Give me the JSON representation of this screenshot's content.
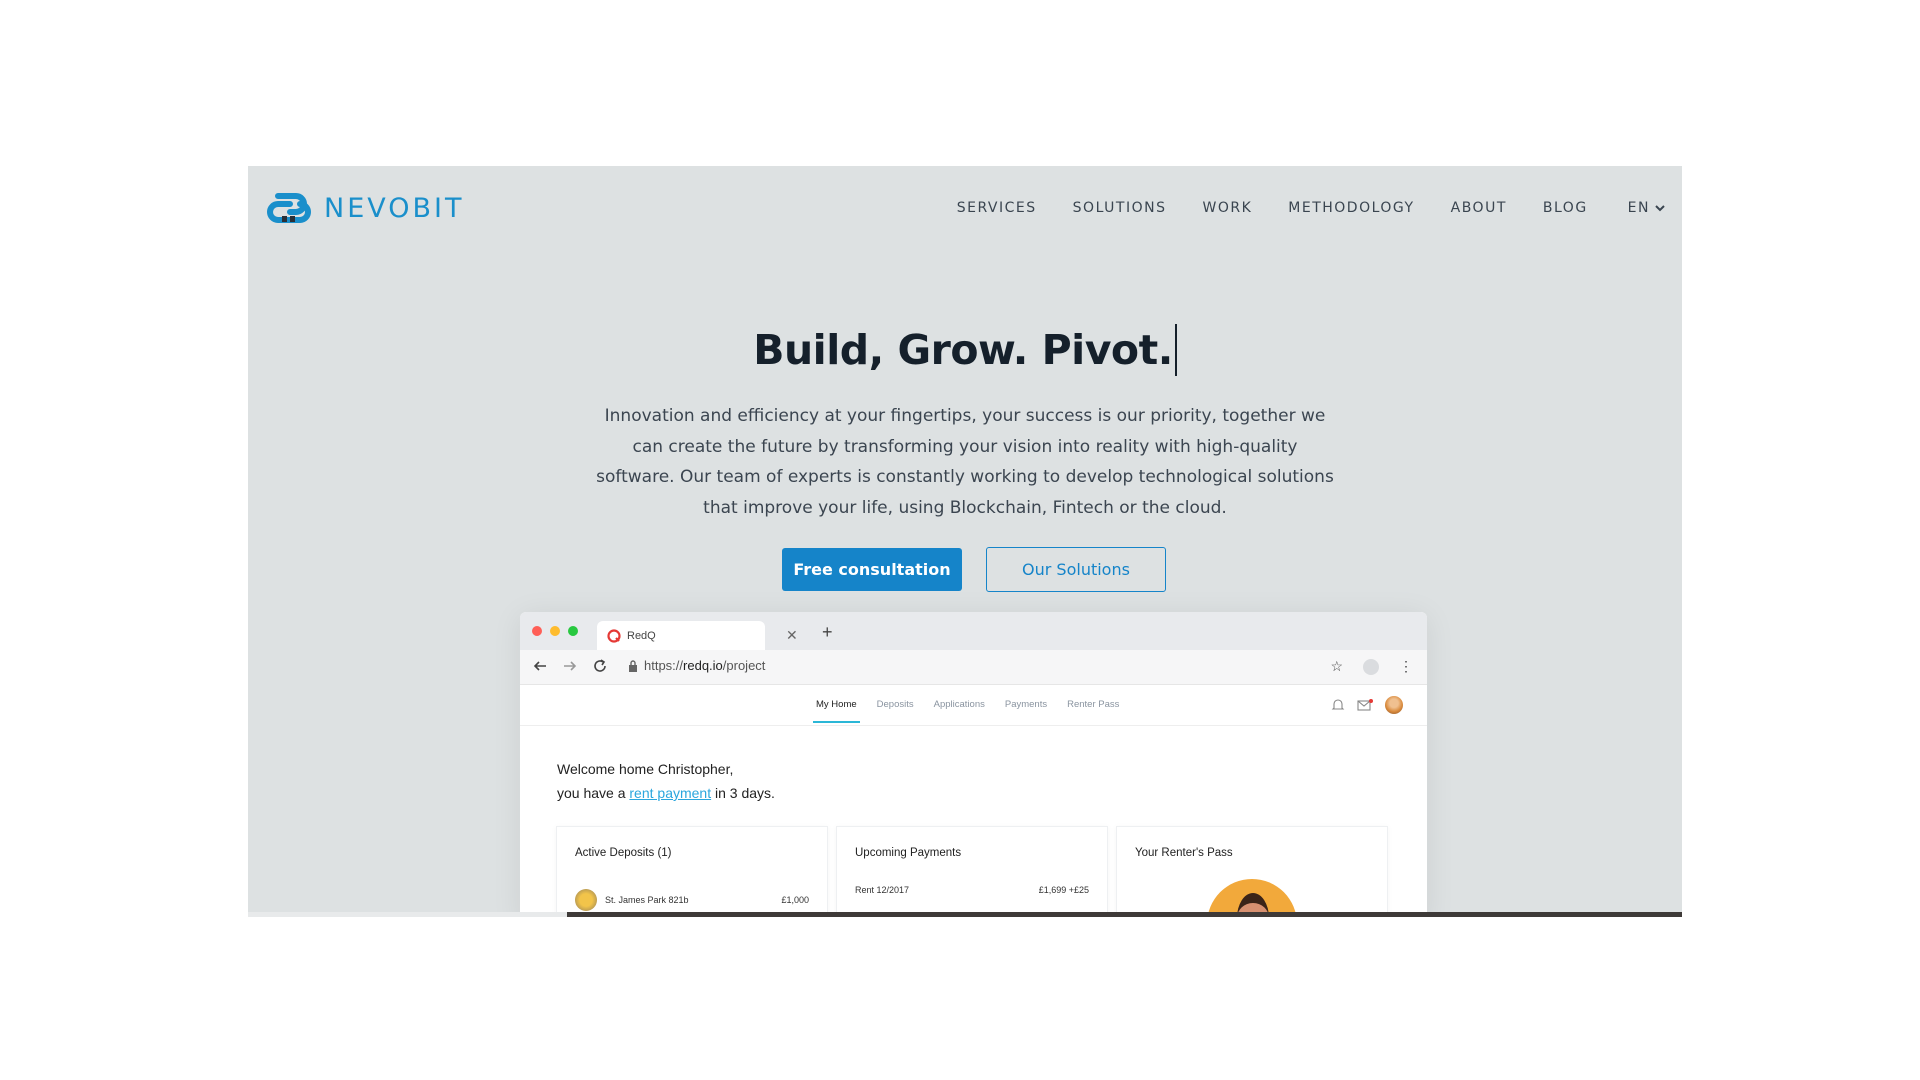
{
  "brand": {
    "name": "NEVOBIT",
    "color": "#1a8fcb"
  },
  "nav": {
    "items": [
      "SERVICES",
      "SOLUTIONS",
      "WORK",
      "METHODOLOGY",
      "ABOUT",
      "BLOG"
    ],
    "lang": "EN"
  },
  "hero": {
    "title": "Build, Grow. Pivot.",
    "text": "Innovation and efficiency at your fingertips, your success is our priority, together we can create the future by transforming your vision into reality with high-quality software. Our team of experts is constantly working to develop technological solutions that improve your life, using Blockchain, Fintech or the cloud.",
    "primary_button": "Free consultation",
    "secondary_button": "Our Solutions"
  },
  "mockup": {
    "tab_title": "RedQ",
    "url_prefix": "https://",
    "url_domain": "redq.io",
    "url_path": "/project",
    "app_tabs": [
      "My Home",
      "Deposits",
      "Applications",
      "Payments",
      "Renter Pass"
    ],
    "welcome_line1": "Welcome home Christopher,",
    "welcome_pre": "you have a ",
    "welcome_link": "rent payment",
    "welcome_post": " in 3 days.",
    "cards": [
      {
        "title": "Active Deposits (1)",
        "row_left": "St. James Park 821b",
        "row_right": "£1,000"
      },
      {
        "title": "Upcoming Payments",
        "row_left": "Rent 12/2017",
        "row_right": "£1,699  +£25"
      },
      {
        "title": "Your Renter's Pass"
      }
    ]
  }
}
